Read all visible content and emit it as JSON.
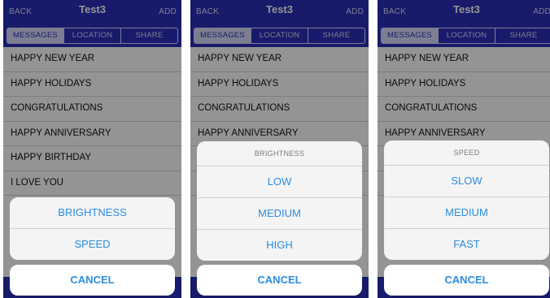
{
  "navbar": {
    "back": "BACK",
    "title": "Test3",
    "add": "ADD"
  },
  "segments": {
    "messages": "MESSAGES",
    "location": "LOCATION",
    "share": "SHARE"
  },
  "messages": [
    "HAPPY NEW YEAR",
    "HAPPY HOLIDAYS",
    "CONGRATULATIONS",
    "HAPPY ANNIVERSARY",
    "HAPPY BIRTHDAY",
    "I LOVE YOU"
  ],
  "screen1": {
    "options": [
      "BRIGHTNESS",
      "SPEED"
    ],
    "cancel": "CANCEL"
  },
  "screen2": {
    "header": "BRIGHTNESS",
    "options": [
      "LOW",
      "MEDIUM",
      "HIGH"
    ],
    "cancel": "CANCEL"
  },
  "screen3": {
    "header": "SPEED",
    "options": [
      "SLOW",
      "MEDIUM",
      "FAST"
    ],
    "cancel": "CANCEL"
  },
  "colors": {
    "accent": "#2a2fb8",
    "link": "#2b8de0"
  }
}
